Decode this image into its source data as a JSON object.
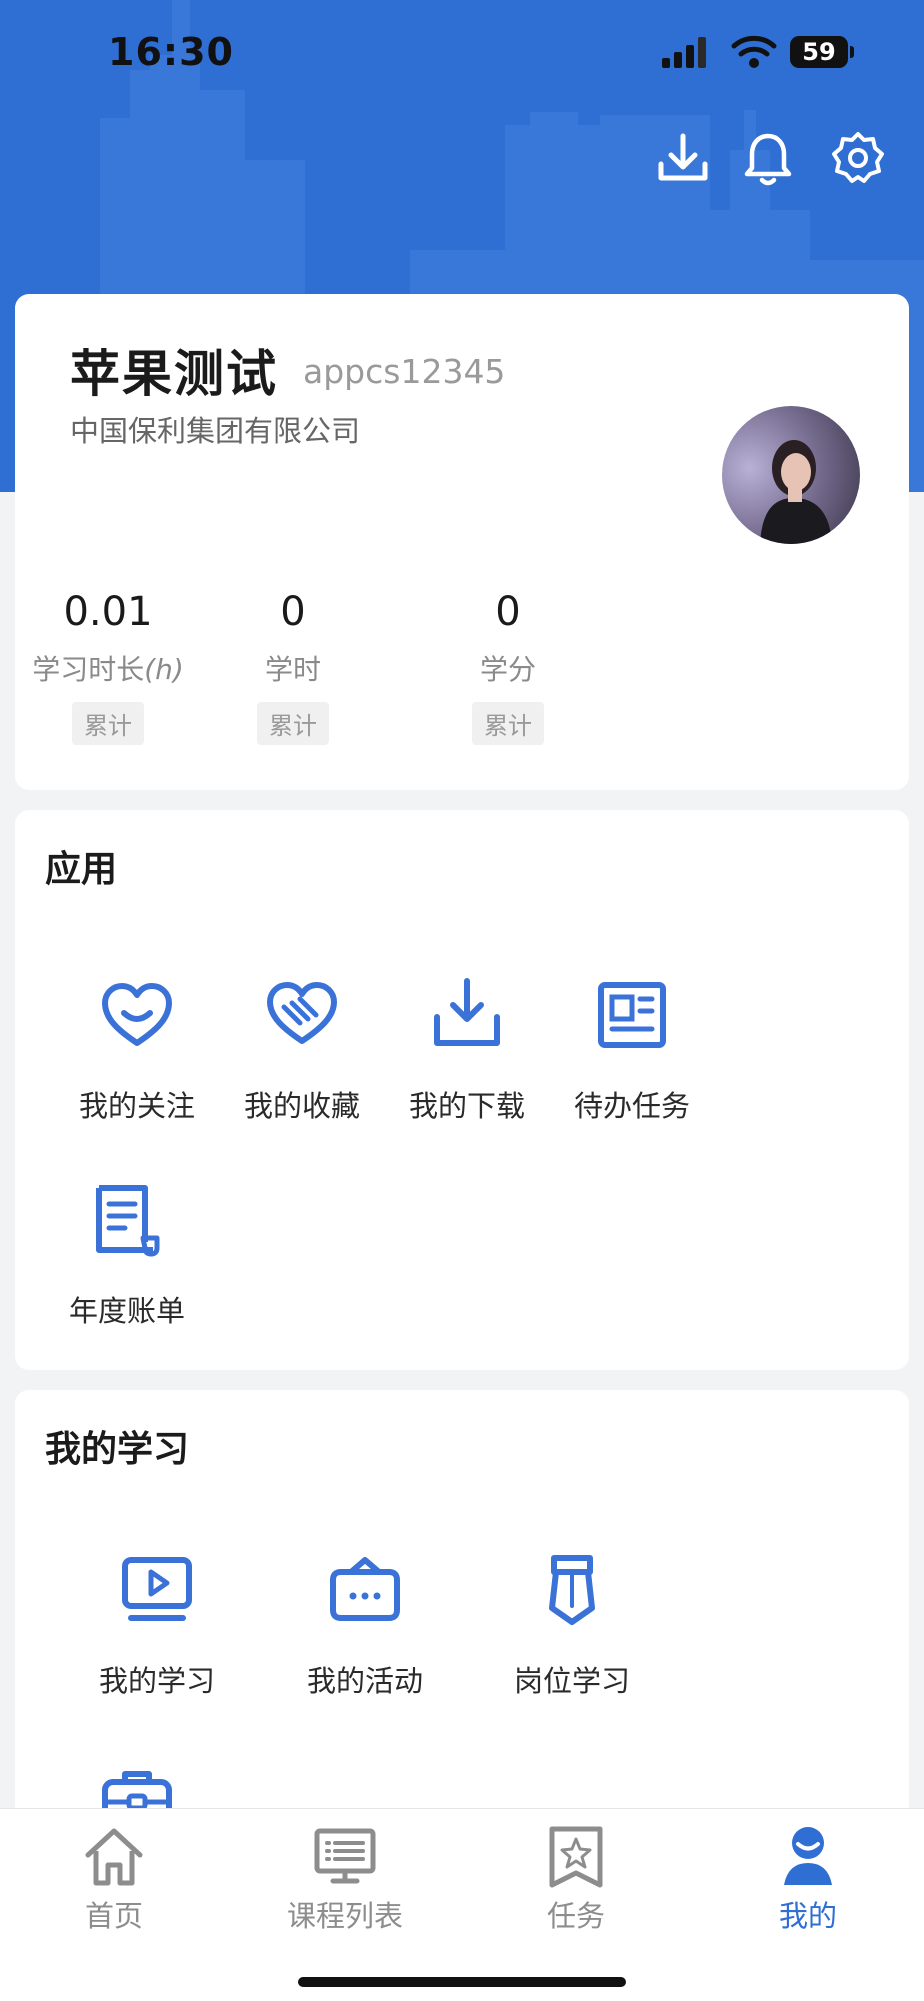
{
  "status_bar": {
    "time": "16:30",
    "battery": "59"
  },
  "profile": {
    "name": "苹果测试",
    "account": "appcs12345",
    "company": "中国保利集团有限公司",
    "stats": [
      {
        "value": "0.01",
        "label": "学习时长",
        "unit": "(h)",
        "tag": "累计"
      },
      {
        "value": "0",
        "label": "学时",
        "tag": "累计"
      },
      {
        "value": "0",
        "label": "学分",
        "tag": "累计"
      }
    ]
  },
  "apps": {
    "title": "应用",
    "items": [
      {
        "label": "我的关注",
        "icon": "heart-smile-icon"
      },
      {
        "label": "我的收藏",
        "icon": "handshake-heart-icon"
      },
      {
        "label": "我的下载",
        "icon": "download-tray-icon"
      },
      {
        "label": "待办任务",
        "icon": "newspaper-icon"
      },
      {
        "label": "年度账单",
        "icon": "bill-scroll-icon"
      }
    ]
  },
  "my_learning": {
    "title": "我的学习",
    "items": [
      {
        "label": "我的学习",
        "icon": "video-play-icon"
      },
      {
        "label": "我的活动",
        "icon": "chat-ticket-icon"
      },
      {
        "label": "岗位学习",
        "icon": "necktie-icon"
      }
    ]
  },
  "tabbar": {
    "items": [
      {
        "label": "首页",
        "icon": "home-icon",
        "active": false
      },
      {
        "label": "课程列表",
        "icon": "course-list-icon",
        "active": false
      },
      {
        "label": "任务",
        "icon": "task-star-icon",
        "active": false
      },
      {
        "label": "我的",
        "icon": "profile-icon",
        "active": true
      }
    ]
  },
  "colors": {
    "primary": "#2f6fd4",
    "icon_blue": "#3a72d8",
    "background": "#f2f3f5"
  }
}
